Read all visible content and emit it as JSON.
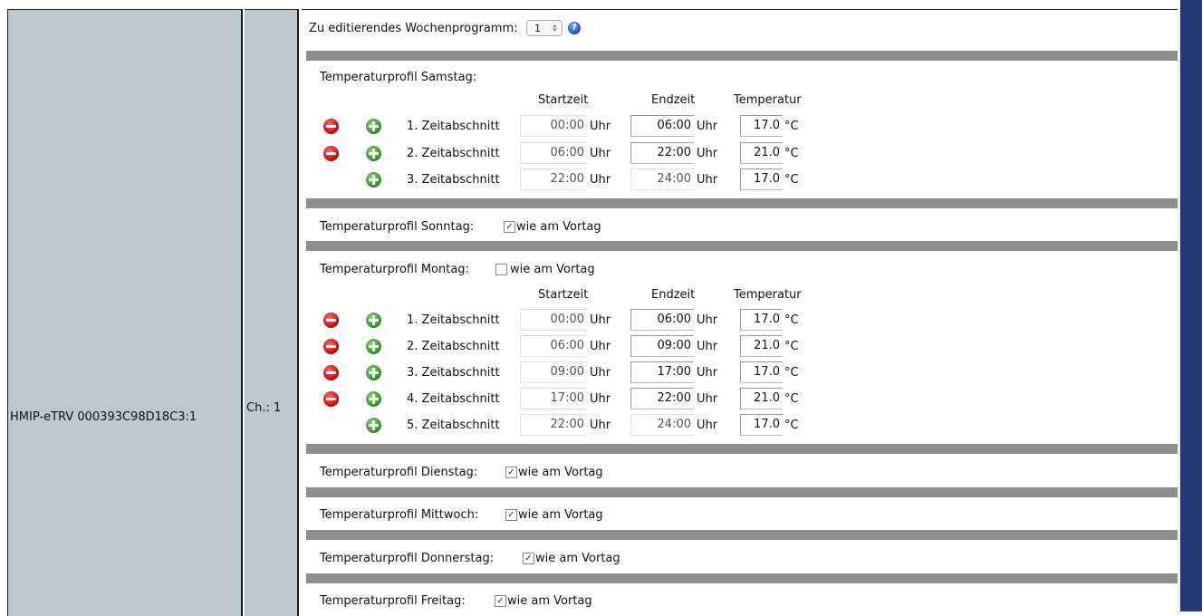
{
  "device": {
    "name": "HMIP-eTRV 000393C98D18C3:1",
    "channel": "Ch.: 1"
  },
  "week_program": {
    "label": "Zu editierendes Wochenprogramm:",
    "selected": "1",
    "help_icon": "help-icon"
  },
  "headers": {
    "start": "Startzeit",
    "end": "Endzeit",
    "temp": "Temperatur"
  },
  "units": {
    "time": "Uhr",
    "temp": "°C"
  },
  "saturday": {
    "label": "Temperaturprofil Samstag:",
    "rows": [
      {
        "name": "1. Zeitabschnitt",
        "start": "00:00",
        "end": "06:00",
        "temp": "17.0"
      },
      {
        "name": "2. Zeitabschnitt",
        "start": "06:00",
        "end": "22:00",
        "temp": "21.0"
      },
      {
        "name": "3. Zeitabschnitt",
        "start": "22:00",
        "end": "24:00",
        "temp": "17.0"
      }
    ]
  },
  "sunday": {
    "label": "Temperaturprofil Sonntag:",
    "same_label": "wie am Vortag",
    "checked": true
  },
  "monday": {
    "label": "Temperaturprofil Montag:",
    "same_label": "wie am Vortag",
    "checked": false,
    "rows": [
      {
        "name": "1. Zeitabschnitt",
        "start": "00:00",
        "end": "06:00",
        "temp": "17.0"
      },
      {
        "name": "2. Zeitabschnitt",
        "start": "06:00",
        "end": "09:00",
        "temp": "21.0"
      },
      {
        "name": "3. Zeitabschnitt",
        "start": "09:00",
        "end": "17:00",
        "temp": "17.0"
      },
      {
        "name": "4. Zeitabschnitt",
        "start": "17:00",
        "end": "22:00",
        "temp": "21.0"
      },
      {
        "name": "5. Zeitabschnitt",
        "start": "22:00",
        "end": "24:00",
        "temp": "17.0"
      }
    ]
  },
  "tuesday": {
    "label": "Temperaturprofil Dienstag:",
    "same_label": "wie am Vortag",
    "checked": true
  },
  "wednesday": {
    "label": "Temperaturprofil Mittwoch:",
    "same_label": "wie am Vortag",
    "checked": true
  },
  "thursday": {
    "label": "Temperaturprofil Donnerstag:",
    "same_label": "wie am Vortag",
    "checked": true
  },
  "friday": {
    "label": "Temperaturprofil Freitag:",
    "same_label": "wie am Vortag",
    "checked": true
  },
  "colors": {
    "left_panel": "#bdc8cd",
    "separator": "#8d8d8d",
    "right_bar": "#263a78"
  }
}
